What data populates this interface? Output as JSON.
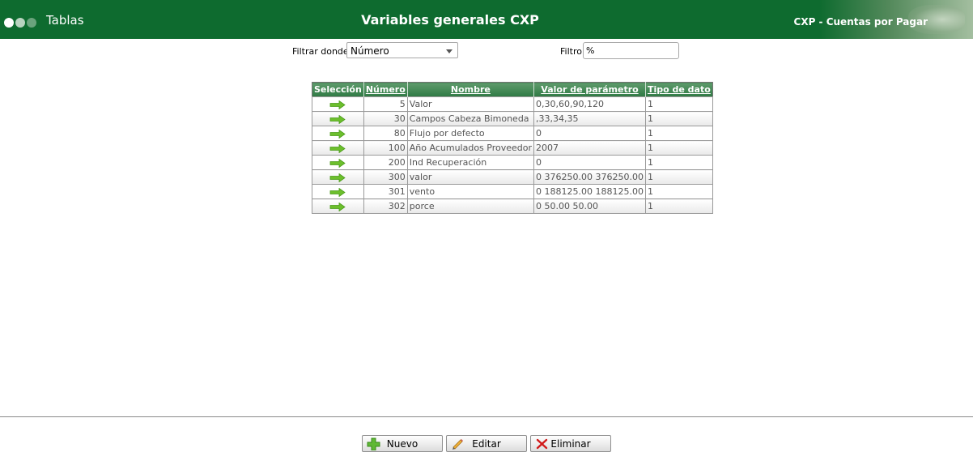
{
  "header": {
    "section": "Tablas",
    "title": "Variables generales CXP",
    "app_name": "CXP - Cuentas por Pagar"
  },
  "filter": {
    "filter_where_label": "Filtrar donde",
    "field_selected": "Número",
    "filter_label": "Filtro",
    "filter_value": "%"
  },
  "table": {
    "headers": {
      "selection": "Selección",
      "number": "Número",
      "name": "Nombre",
      "value": "Valor de parámetro",
      "type": "Tipo de dato"
    },
    "rows": [
      {
        "number": "5",
        "name": "Valor",
        "value": "0,30,60,90,120",
        "type": "1"
      },
      {
        "number": "30",
        "name": "Campos Cabeza Bimoneda",
        "value": ",33,34,35",
        "type": "1"
      },
      {
        "number": "80",
        "name": "Flujo por defecto",
        "value": "0",
        "type": "1"
      },
      {
        "number": "100",
        "name": "Año Acumulados Proveedor",
        "value": "2007",
        "type": "1"
      },
      {
        "number": "200",
        "name": "Ind Recuperación",
        "value": "0",
        "type": "1"
      },
      {
        "number": "300",
        "name": "valor",
        "value": "0 376250.00 376250.00",
        "type": "1"
      },
      {
        "number": "301",
        "name": "vento",
        "value": "0 188125.00 188125.00",
        "type": "1"
      },
      {
        "number": "302",
        "name": "porce",
        "value": "0 50.00 50.00",
        "type": "1"
      }
    ]
  },
  "actions": {
    "new_label": "Nuevo",
    "edit_label": "Editar",
    "delete_label": "Eliminar"
  },
  "colors": {
    "header_green": "#0e6b2f",
    "arrow_green": "#6cbf2c",
    "delete_red": "#d11a1a"
  }
}
